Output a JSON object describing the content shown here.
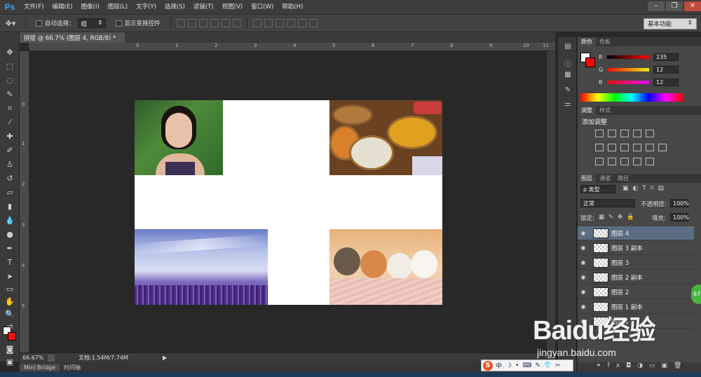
{
  "app": {
    "logo": "Ps"
  },
  "menu": [
    "文件(F)",
    "编辑(E)",
    "图像(I)",
    "图层(L)",
    "文字(Y)",
    "选择(S)",
    "滤镜(T)",
    "视图(V)",
    "窗口(W)",
    "帮助(H)"
  ],
  "window_controls": {
    "minimize": "–",
    "restore": "❐",
    "close": "✕"
  },
  "options": {
    "auto_select_label": "自动选择：",
    "auto_select_value": "组",
    "show_transform_label": "显示变换控件",
    "workspace": "基本功能"
  },
  "document": {
    "tab_title": "拼接 @ 66.7% (图层 4, RGB/8) *",
    "zoom": "66.67%",
    "doc_size": "文档:1.54M/7.74M"
  },
  "ruler": {
    "top_ticks": [
      "0",
      "1",
      "2",
      "3",
      "4",
      "5",
      "6",
      "7",
      "8",
      "9",
      "10",
      "11"
    ],
    "left_ticks": [
      "0",
      "1",
      "2",
      "3",
      "4",
      "5"
    ]
  },
  "bottom_tabs": [
    "Mini Bridge",
    "时间轴"
  ],
  "color_panel": {
    "tabs": [
      "颜色",
      "色板"
    ],
    "r_label": "R",
    "r": "235",
    "g_label": "G",
    "g": "12",
    "b_label": "B",
    "b": "12",
    "foreground": "#eb0c0c",
    "background": "#ffffff"
  },
  "adjust_panel": {
    "tabs": [
      "调整",
      "样式"
    ],
    "title": "添加调整"
  },
  "layers_panel": {
    "tabs": [
      "图层",
      "通道",
      "路径"
    ],
    "filter_label": "ρ 类型",
    "blend_mode": "正常",
    "opacity_label": "不透明度:",
    "opacity": "100%",
    "lock_label": "锁定:",
    "fill_label": "填充:",
    "fill": "100%",
    "layers": [
      "图层 4",
      "图层 3 副本",
      "图层 3",
      "图层 2 副本",
      "图层 2",
      "图层 1 副本",
      "图层 1"
    ]
  },
  "watermark": {
    "logo": "Baidu经验",
    "url": "jingyan.baidu.com"
  },
  "ime": {
    "icon": "S",
    "lang": "中"
  },
  "side_badge": "67"
}
